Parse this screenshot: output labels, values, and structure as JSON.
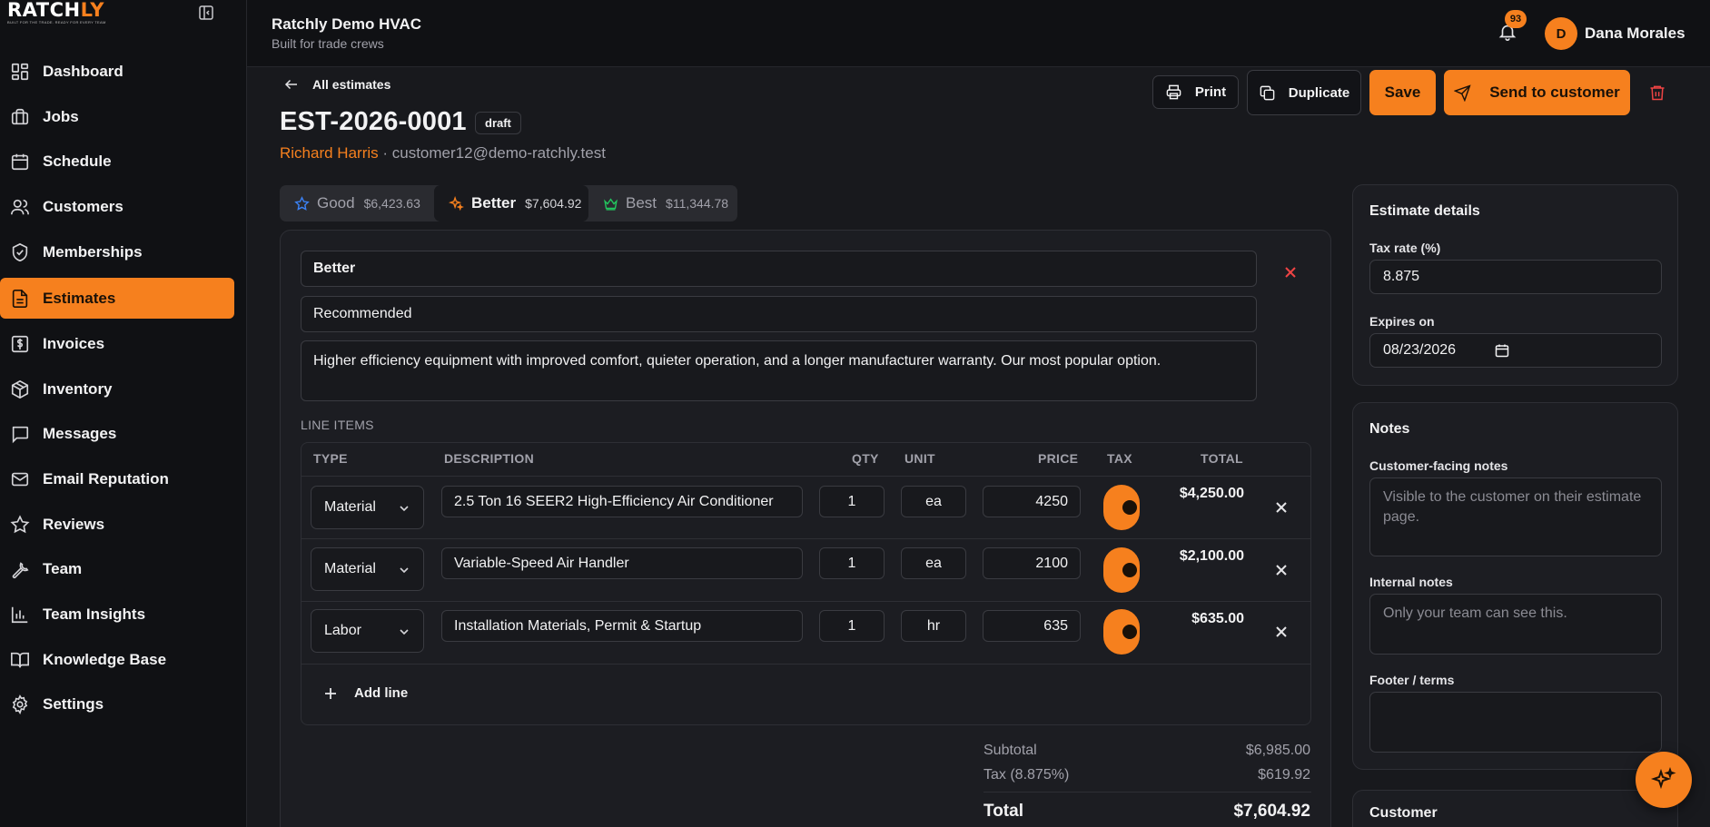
{
  "brand": {
    "logo_text_a": "RATCH",
    "logo_text_b": "LY",
    "logo_tagline": "BUILT FOR THE TRADE. READY FOR EVERY TEAM",
    "accent_color": "#f6801e"
  },
  "sidebar": {
    "items": [
      {
        "label": "Dashboard",
        "icon": "dashboard-icon",
        "active": false
      },
      {
        "label": "Jobs",
        "icon": "briefcase-icon",
        "active": false
      },
      {
        "label": "Schedule",
        "icon": "calendar-icon",
        "active": false
      },
      {
        "label": "Customers",
        "icon": "users-icon",
        "active": false
      },
      {
        "label": "Memberships",
        "icon": "shield-check-icon",
        "active": false
      },
      {
        "label": "Estimates",
        "icon": "document-icon",
        "active": true
      },
      {
        "label": "Invoices",
        "icon": "invoice-dollar-icon",
        "active": false
      },
      {
        "label": "Inventory",
        "icon": "package-icon",
        "active": false
      },
      {
        "label": "Messages",
        "icon": "message-icon",
        "active": false
      },
      {
        "label": "Email Reputation",
        "icon": "mail-icon",
        "active": false
      },
      {
        "label": "Reviews",
        "icon": "star-icon",
        "active": false
      },
      {
        "label": "Team",
        "icon": "wrench-icon",
        "active": false
      },
      {
        "label": "Team Insights",
        "icon": "bar-chart-icon",
        "active": false
      },
      {
        "label": "Knowledge Base",
        "icon": "book-icon",
        "active": false
      },
      {
        "label": "Settings",
        "icon": "gear-icon",
        "active": false
      }
    ]
  },
  "header": {
    "org_name": "Ratchly Demo HVAC",
    "org_tagline": "Built for trade crews",
    "notification_count": "93",
    "avatar_initial": "D",
    "user_name": "Dana Morales"
  },
  "estimate": {
    "back_label": "All estimates",
    "number": "EST-2026-0001",
    "status": "draft",
    "customer_name": "Richard Harris",
    "customer_separator": " · ",
    "customer_email": "customer12@demo-ratchly.test",
    "actions": {
      "print": "Print",
      "duplicate": "Duplicate",
      "save": "Save",
      "send": "Send to customer"
    },
    "tiers": [
      {
        "name": "Good",
        "price": "$6,423.63",
        "icon": "star-icon",
        "active": false
      },
      {
        "name": "Better",
        "price": "$7,604.92",
        "icon": "sparkles-icon",
        "active": true
      },
      {
        "name": "Best",
        "price": "$11,344.78",
        "icon": "crown-icon",
        "active": false
      }
    ],
    "option": {
      "name": "Better",
      "label": "Recommended",
      "description": "Higher efficiency equipment with improved comfort, quieter operation, and a longer manufacturer warranty. Our most popular option."
    },
    "line_items_label": "LINE ITEMS",
    "columns": [
      "TYPE",
      "DESCRIPTION",
      "QTY",
      "UNIT",
      "PRICE",
      "TAX",
      "TOTAL"
    ],
    "line_items": [
      {
        "type": "Material",
        "description": "2.5 Ton 16 SEER2 High-Efficiency Air Conditioner",
        "qty": "1",
        "unit": "ea",
        "price": "4250",
        "taxable": true,
        "total": "$4,250.00"
      },
      {
        "type": "Material",
        "description": "Variable-Speed Air Handler",
        "qty": "1",
        "unit": "ea",
        "price": "2100",
        "taxable": true,
        "total": "$2,100.00"
      },
      {
        "type": "Labor",
        "description": "Installation Materials, Permit & Startup",
        "qty": "1",
        "unit": "hr",
        "price": "635",
        "taxable": true,
        "total": "$635.00"
      }
    ],
    "add_line_label": "Add line",
    "totals": {
      "subtotal_label": "Subtotal",
      "subtotal": "$6,985.00",
      "tax_label": "Tax (8.875%)",
      "tax": "$619.92",
      "total_label": "Total",
      "total": "$7,604.92"
    }
  },
  "details": {
    "title": "Estimate details",
    "tax_rate_label": "Tax rate (%)",
    "tax_rate": "8.875",
    "expires_label": "Expires on",
    "expires": "08/23/2026"
  },
  "notes": {
    "title": "Notes",
    "customer_label": "Customer-facing notes",
    "customer_placeholder": "Visible to the customer on their estimate page.",
    "internal_label": "Internal notes",
    "internal_placeholder": "Only your team can see this.",
    "footer_label": "Footer / terms",
    "footer_value": ""
  },
  "customer_card": {
    "title": "Customer"
  }
}
